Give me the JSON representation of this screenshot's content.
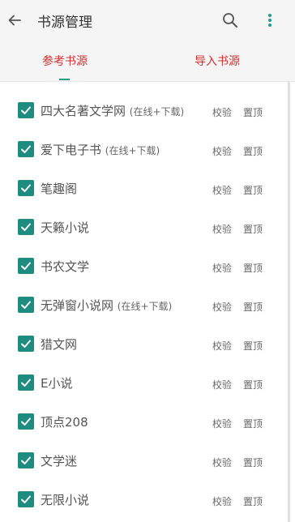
{
  "appbar": {
    "title": "书源管理",
    "back_icon": "arrow-left-icon",
    "search_icon": "search-icon",
    "more_icon": "more-vertical-icon"
  },
  "tabs": [
    {
      "label": "参考书源",
      "active": true
    },
    {
      "label": "导入书源",
      "active": false
    }
  ],
  "colors": {
    "accent": "#1e9e8c",
    "checkbox": "#1f8c80",
    "tab_text": "#d32f2f",
    "appbar_bg": "#f5f5f5"
  },
  "sources": [
    {
      "name": "四大名著文学网",
      "note": "(在线+下载)",
      "checked": true,
      "verify": "校验",
      "pin": "置顶"
    },
    {
      "name": "爱下电子书",
      "note": "(在线+下载)",
      "checked": true,
      "verify": "校验",
      "pin": "置顶"
    },
    {
      "name": "笔趣阁",
      "note": "",
      "checked": true,
      "verify": "校验",
      "pin": "置顶"
    },
    {
      "name": "天籁小说",
      "note": "",
      "checked": true,
      "verify": "校验",
      "pin": "置顶"
    },
    {
      "name": "书农文学",
      "note": "",
      "checked": true,
      "verify": "校验",
      "pin": "置顶"
    },
    {
      "name": "无弹窗小说网",
      "note": "(在线+下载)",
      "checked": true,
      "verify": "校验",
      "pin": "置顶"
    },
    {
      "name": "猎文网",
      "note": "",
      "checked": true,
      "verify": "校验",
      "pin": "置顶"
    },
    {
      "name": "E小说",
      "note": "",
      "checked": true,
      "verify": "校验",
      "pin": "置顶"
    },
    {
      "name": "顶点208",
      "note": "",
      "checked": true,
      "verify": "校验",
      "pin": "置顶"
    },
    {
      "name": "文学迷",
      "note": "",
      "checked": true,
      "verify": "校验",
      "pin": "置顶"
    },
    {
      "name": "无限小说",
      "note": "",
      "checked": true,
      "verify": "校验",
      "pin": "置顶"
    }
  ]
}
